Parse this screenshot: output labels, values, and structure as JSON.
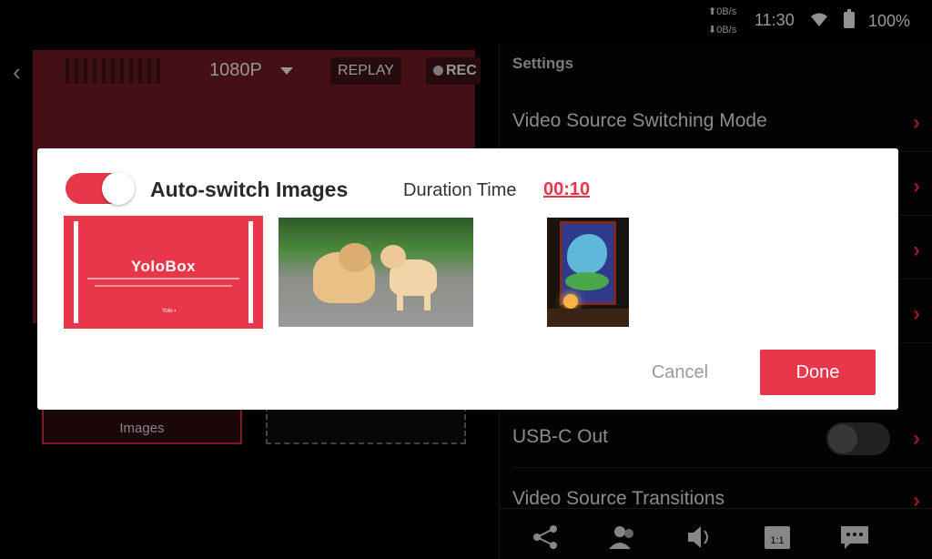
{
  "status_bar": {
    "upload_speed": "⬆0B/s",
    "download_speed": "⬇0B/s",
    "time": "11:30",
    "battery": "100%"
  },
  "preview": {
    "resolution": "1080P",
    "replay_label": "REPLAY",
    "rec_label": "REC",
    "source_images_label": "Images"
  },
  "settings": {
    "title": "Settings",
    "rows": [
      {
        "label": "Video Source Switching Mode"
      },
      {
        "label": "USB-C Out"
      },
      {
        "label": "Video Source Transitions"
      }
    ],
    "usbc_toggle_on": false
  },
  "modal": {
    "auto_switch_label": "Auto-switch Images",
    "auto_switch_on": true,
    "duration_label": "Duration Time",
    "duration_value": "00:10",
    "yolobox_title": "YoloBox",
    "cancel_label": "Cancel",
    "done_label": "Done"
  },
  "colors": {
    "accent": "#e8364a",
    "background": "#000000",
    "modal_bg": "#ffffff"
  },
  "icons": [
    "back-icon",
    "wifi-icon",
    "battery-icon",
    "chevron-right-icon",
    "share-icon",
    "users-icon",
    "volume-icon",
    "aspect-ratio-icon",
    "chat-icon"
  ]
}
